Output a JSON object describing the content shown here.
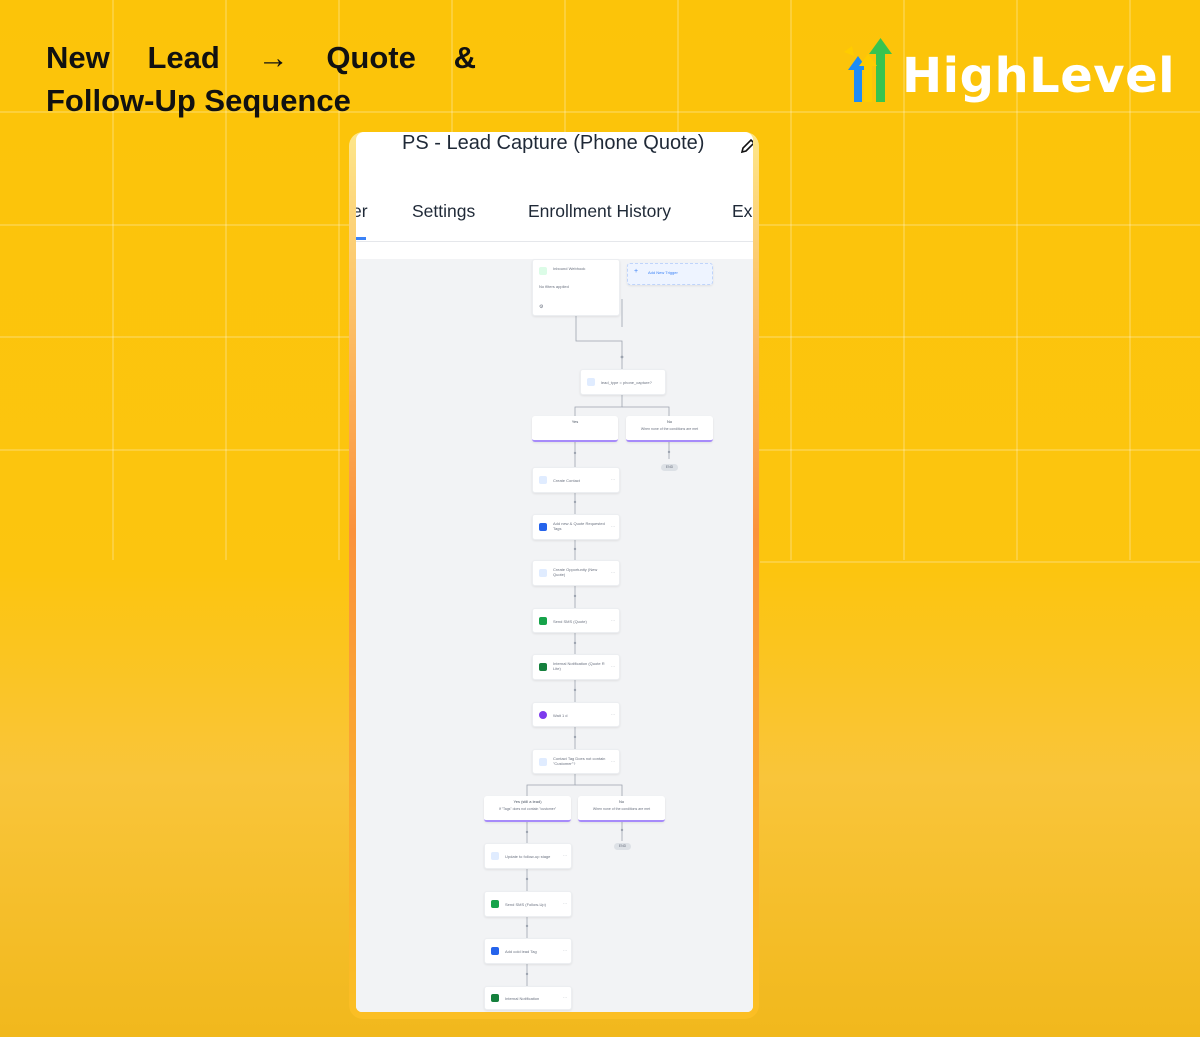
{
  "heading": {
    "line1_words": [
      "New",
      "Lead",
      "→",
      "Quote",
      "&"
    ],
    "line2": "Follow-Up Sequence"
  },
  "brand": {
    "name": "HighLevel",
    "colors": {
      "blue": "#1d8cf8",
      "green": "#37c44f",
      "yellow": "#ffcc00"
    }
  },
  "workflow": {
    "title": "PS - Lead Capture (Phone Quote)",
    "tabs": [
      {
        "label": "er",
        "active": true
      },
      {
        "label": "Settings"
      },
      {
        "label": "Enrollment History"
      },
      {
        "label": "Ex"
      }
    ],
    "trigger": {
      "title": "Inbound Webhook",
      "filters": "No filters applied"
    },
    "add_trigger": "Add New Trigger",
    "condition1": "lead_type = phone_capture?",
    "branch_yes": {
      "label": "Yes"
    },
    "branch_no": {
      "label": "No",
      "subtitle": "When none of the conditions are met"
    },
    "end1": "END",
    "actions": [
      {
        "icon": "contact-icon",
        "label": "Create Contact"
      },
      {
        "icon": "tag-icon",
        "label": "Add new & Quote Requested Tags"
      },
      {
        "icon": "opportunity-icon",
        "label": "Create Opportunity (New Quote)"
      },
      {
        "icon": "sms-icon",
        "label": "Send SMS (Quote)"
      },
      {
        "icon": "notification-icon",
        "label": "Internal Notification (Quote R Lite)"
      },
      {
        "icon": "wait-icon",
        "label": "Wait 1 d"
      },
      {
        "icon": "condition-icon",
        "label": "Contact Tag Does not contain \"Customer\"?"
      }
    ],
    "branch2_yes": {
      "label": "Yes (still a lead)",
      "subtitle": "If \"Tags\" does not contain \"customer\""
    },
    "branch2_no": {
      "label": "No",
      "subtitle": "When none of the conditions are met"
    },
    "end2": "END",
    "actions2": [
      {
        "icon": "opportunity-icon",
        "label": "Update to follow-up stage"
      },
      {
        "icon": "sms-icon",
        "label": "Send SMS (Follow-Up)"
      },
      {
        "icon": "tag-icon",
        "label": "Add cold lead Tag"
      },
      {
        "icon": "notification-icon",
        "label": "Internal Notification"
      }
    ]
  }
}
